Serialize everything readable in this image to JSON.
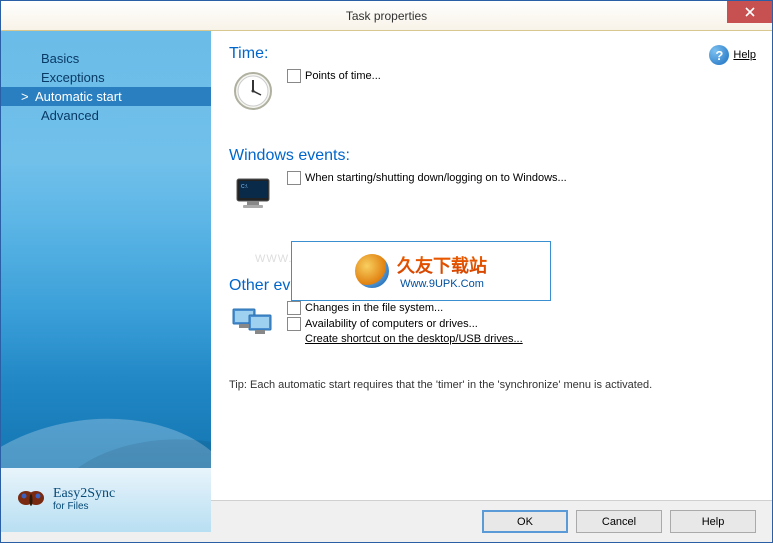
{
  "window": {
    "title": "Task properties"
  },
  "sidebar": {
    "items": [
      {
        "label": "Basics"
      },
      {
        "label": "Exceptions"
      },
      {
        "label": "Automatic start"
      },
      {
        "label": "Advanced"
      }
    ],
    "active_index": 2
  },
  "help": {
    "label": "Help"
  },
  "sections": {
    "time": {
      "title": "Time:",
      "options": [
        {
          "label": "Points of time..."
        }
      ]
    },
    "windows_events": {
      "title": "Windows events:",
      "options": [
        {
          "label": "When starting/shutting down/logging on to Windows..."
        }
      ]
    },
    "other_events": {
      "title": "Other events:",
      "options": [
        {
          "label": "Changes in the file system..."
        },
        {
          "label": "Availability of computers or drives..."
        }
      ],
      "link": "Create shortcut on the desktop/USB drives..."
    }
  },
  "tip": "Tip: Each automatic start requires that the 'timer' in the 'synchronize' menu is activated.",
  "logo": {
    "name": "Easy2Sync",
    "sub": "for Files"
  },
  "buttons": {
    "ok": "OK",
    "cancel": "Cancel",
    "help": "Help"
  },
  "watermark": {
    "cn": "久友下载站",
    "url": "Www.9UPK.Com",
    "ghost": "WWW.9UPK.COM"
  }
}
